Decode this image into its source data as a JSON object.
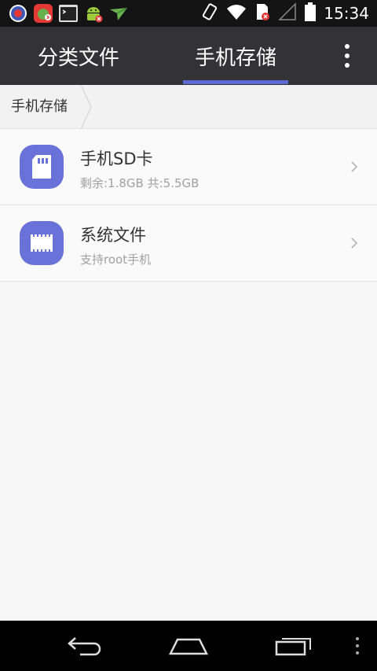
{
  "statusbar": {
    "time": "15:34",
    "left_icons": [
      "screen-record-icon",
      "game-app-icon",
      "terminal-app-icon",
      "android-debug-icon",
      "send-app-icon"
    ],
    "right_icons": [
      "vibrate-icon",
      "wifi-icon",
      "sim-icon",
      "signal-icon",
      "battery-icon"
    ]
  },
  "tabs": [
    {
      "label": "分类文件",
      "active": false
    },
    {
      "label": "手机存储",
      "active": true
    }
  ],
  "breadcrumb": {
    "current": "手机存储"
  },
  "items": [
    {
      "title": "手机SD卡",
      "subtitle": "剩余:1.8GB  共:5.5GB",
      "icon": "sd-card-icon"
    },
    {
      "title": "系统文件",
      "subtitle": "支持root手机",
      "icon": "chip-icon"
    }
  ],
  "colors": {
    "appbar": "#333335",
    "accent": "#5c6bd4",
    "icon_bg": "#6872d8",
    "background": "#f7f7f7"
  }
}
